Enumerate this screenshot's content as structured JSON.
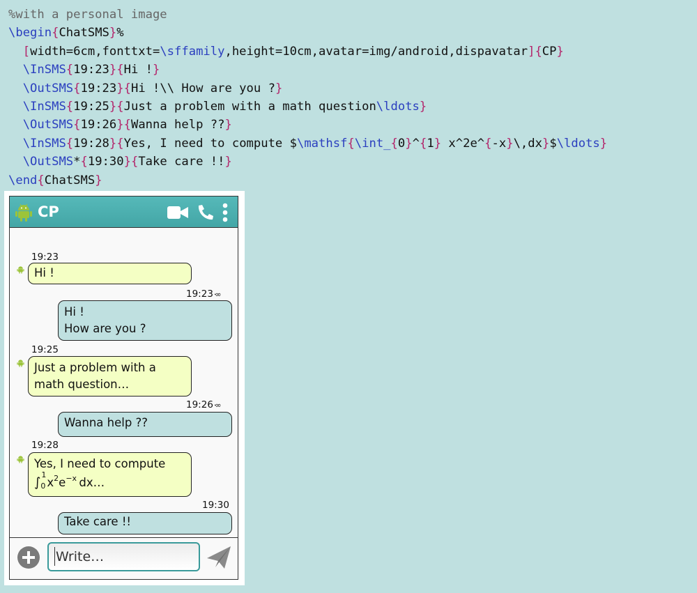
{
  "code_lines": [
    [
      {
        "t": "%with a personal image",
        "c": "comment"
      }
    ],
    [
      {
        "t": "\\begin",
        "c": "macro"
      },
      {
        "t": "{",
        "c": "brace"
      },
      {
        "t": "ChatSMS",
        "c": "text"
      },
      {
        "t": "}",
        "c": "brace"
      },
      {
        "t": "%",
        "c": "text"
      }
    ],
    [
      {
        "t": "  ",
        "c": "text"
      },
      {
        "t": "[",
        "c": "brace"
      },
      {
        "t": "width=6cm,fonttxt=",
        "c": "text"
      },
      {
        "t": "\\sffamily",
        "c": "macro"
      },
      {
        "t": ",height=10cm,avatar=img/android,dispavatar",
        "c": "text"
      },
      {
        "t": "]",
        "c": "brace"
      },
      {
        "t": "{",
        "c": "brace"
      },
      {
        "t": "CP",
        "c": "text"
      },
      {
        "t": "}",
        "c": "brace"
      }
    ],
    [
      {
        "t": "  ",
        "c": "text"
      },
      {
        "t": "\\InSMS",
        "c": "macro"
      },
      {
        "t": "{",
        "c": "brace"
      },
      {
        "t": "19:23",
        "c": "text"
      },
      {
        "t": "}",
        "c": "brace"
      },
      {
        "t": "{",
        "c": "brace"
      },
      {
        "t": "Hi !",
        "c": "text"
      },
      {
        "t": "}",
        "c": "brace"
      }
    ],
    [
      {
        "t": "  ",
        "c": "text"
      },
      {
        "t": "\\OutSMS",
        "c": "macro"
      },
      {
        "t": "{",
        "c": "brace"
      },
      {
        "t": "19:23",
        "c": "text"
      },
      {
        "t": "}",
        "c": "brace"
      },
      {
        "t": "{",
        "c": "brace"
      },
      {
        "t": "Hi !\\\\ How are you ?",
        "c": "text"
      },
      {
        "t": "}",
        "c": "brace"
      }
    ],
    [
      {
        "t": "  ",
        "c": "text"
      },
      {
        "t": "\\InSMS",
        "c": "macro"
      },
      {
        "t": "{",
        "c": "brace"
      },
      {
        "t": "19:25",
        "c": "text"
      },
      {
        "t": "}",
        "c": "brace"
      },
      {
        "t": "{",
        "c": "brace"
      },
      {
        "t": "Just a problem with a math question",
        "c": "text"
      },
      {
        "t": "\\ldots",
        "c": "macro"
      },
      {
        "t": "}",
        "c": "brace"
      }
    ],
    [
      {
        "t": "  ",
        "c": "text"
      },
      {
        "t": "\\OutSMS",
        "c": "macro"
      },
      {
        "t": "{",
        "c": "brace"
      },
      {
        "t": "19:26",
        "c": "text"
      },
      {
        "t": "}",
        "c": "brace"
      },
      {
        "t": "{",
        "c": "brace"
      },
      {
        "t": "Wanna help ??",
        "c": "text"
      },
      {
        "t": "}",
        "c": "brace"
      }
    ],
    [
      {
        "t": "  ",
        "c": "text"
      },
      {
        "t": "\\InSMS",
        "c": "macro"
      },
      {
        "t": "{",
        "c": "brace"
      },
      {
        "t": "19:28",
        "c": "text"
      },
      {
        "t": "}",
        "c": "brace"
      },
      {
        "t": "{",
        "c": "brace"
      },
      {
        "t": "Yes, I need to compute $",
        "c": "text"
      },
      {
        "t": "\\mathsf",
        "c": "macro"
      },
      {
        "t": "{",
        "c": "brace"
      },
      {
        "t": "\\int_",
        "c": "macro"
      },
      {
        "t": "{",
        "c": "brace"
      },
      {
        "t": "0",
        "c": "text"
      },
      {
        "t": "}",
        "c": "brace"
      },
      {
        "t": "^",
        "c": "text"
      },
      {
        "t": "{",
        "c": "brace"
      },
      {
        "t": "1",
        "c": "text"
      },
      {
        "t": "}",
        "c": "brace"
      },
      {
        "t": " x^2e^",
        "c": "text"
      },
      {
        "t": "{",
        "c": "brace"
      },
      {
        "t": "-x",
        "c": "text"
      },
      {
        "t": "}",
        "c": "brace"
      },
      {
        "t": "\\,dx",
        "c": "text"
      },
      {
        "t": "}",
        "c": "brace"
      },
      {
        "t": "$",
        "c": "text"
      },
      {
        "t": "\\ldots",
        "c": "macro"
      },
      {
        "t": "}",
        "c": "brace"
      }
    ],
    [
      {
        "t": "  ",
        "c": "text"
      },
      {
        "t": "\\OutSMS",
        "c": "macro"
      },
      {
        "t": "*",
        "c": "text"
      },
      {
        "t": "{",
        "c": "brace"
      },
      {
        "t": "19:30",
        "c": "text"
      },
      {
        "t": "}",
        "c": "brace"
      },
      {
        "t": "{",
        "c": "brace"
      },
      {
        "t": "Take care !!",
        "c": "text"
      },
      {
        "t": "}",
        "c": "brace"
      }
    ],
    [
      {
        "t": "\\end",
        "c": "macro"
      },
      {
        "t": "{",
        "c": "brace"
      },
      {
        "t": "ChatSMS",
        "c": "text"
      },
      {
        "t": "}",
        "c": "brace"
      }
    ]
  ],
  "phone": {
    "contact_name": "CP",
    "header_icons": [
      "android-icon",
      "video-camera-icon",
      "phone-icon",
      "more-vertical-icon"
    ],
    "colors": {
      "header": "#4aaeae",
      "incoming_bubble": "#f4ffc4",
      "outgoing_bubble": "#bfe0e0",
      "avatar_green": "#9cc43a"
    },
    "messages": {
      "m1": {
        "time": "19:23",
        "lines": [
          "Hi !"
        ]
      },
      "m2": {
        "time": "19:23",
        "status": "·∞",
        "lines": [
          "Hi !",
          "How are you ?"
        ]
      },
      "m3": {
        "time": "19:25",
        "lines": [
          "Just a problem with a",
          "math question…"
        ]
      },
      "m4": {
        "time": "19:26",
        "status": "·∞",
        "lines": [
          "Wanna help ??"
        ]
      },
      "m5": {
        "time": "19:28",
        "lines": [
          "Yes, I need to compute"
        ],
        "math": {
          "integral": "∫",
          "lower": "0",
          "upper": "1",
          "x": "x",
          "exp2": "2",
          "e": "e",
          "expx": "−x",
          "dx": "dx…"
        }
      },
      "m6": {
        "time": "19:30",
        "lines": [
          "Take care !!"
        ]
      }
    },
    "input": {
      "placeholder": "Write…"
    }
  }
}
